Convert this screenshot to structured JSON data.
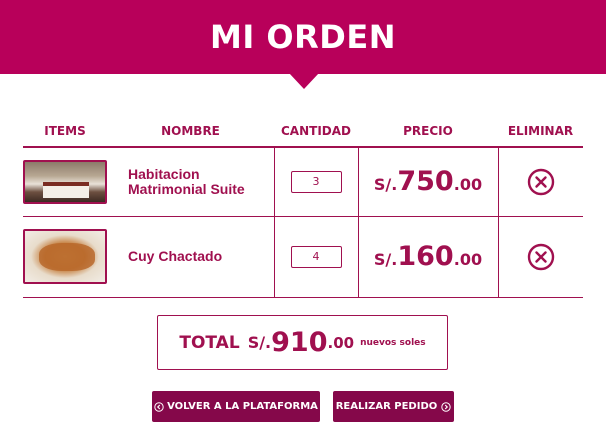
{
  "header": {
    "title": "MI ORDEN"
  },
  "columns": {
    "items": "ITEMS",
    "nombre": "NOMBRE",
    "cantidad": "CANTIDAD",
    "precio": "PRECIO",
    "eliminar": "ELIMINAR"
  },
  "rows": [
    {
      "image": "hotel-room-photo",
      "name": "Habitacion Matrimonial Suite",
      "quantity": "3",
      "price_currency": "S/.",
      "price_int": "750",
      "price_dec": ".00",
      "delete_icon": "close-circle-icon"
    },
    {
      "image": "cuy-chactado-dish-photo",
      "name": "Cuy Chactado",
      "quantity": "4",
      "price_currency": "S/.",
      "price_int": "160",
      "price_dec": ".00",
      "delete_icon": "close-circle-icon"
    }
  ],
  "total": {
    "label": "TOTAL",
    "currency": "S/.",
    "int": "910",
    "dec": ".00",
    "unit": "nuevos soles"
  },
  "buttons": {
    "back": {
      "label": "VOLVER A LA PLATAFORMA",
      "icon": "chevron-left-circle-icon"
    },
    "order": {
      "label": "REALIZAR PEDIDO",
      "icon": "chevron-right-circle-icon"
    }
  },
  "colors": {
    "brand": "#b8005a",
    "text": "#a0104f",
    "button": "#85084a"
  }
}
